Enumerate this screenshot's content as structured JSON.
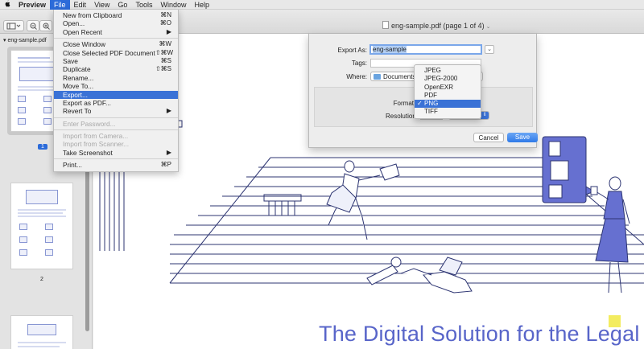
{
  "menubar": {
    "app": "Preview",
    "items": [
      "File",
      "Edit",
      "View",
      "Go",
      "Tools",
      "Window",
      "Help"
    ]
  },
  "window": {
    "title": "eng-sample.pdf (page 1 of 4)"
  },
  "sidebar": {
    "doc_name": "eng-sample.pdf",
    "pages": [
      "1",
      "2"
    ]
  },
  "file_menu": {
    "items": [
      {
        "label": "New from Clipboard",
        "shortcut": "⌘N"
      },
      {
        "label": "Open...",
        "shortcut": "⌘O"
      },
      {
        "label": "Open Recent",
        "shortcut": "▶"
      },
      {
        "label": "Close Window",
        "shortcut": "⌘W"
      },
      {
        "label": "Close Selected PDF Document",
        "shortcut": "⇧⌘W"
      },
      {
        "label": "Save",
        "shortcut": "⌘S"
      },
      {
        "label": "Duplicate",
        "shortcut": "⇧⌘S"
      },
      {
        "label": "Rename...",
        "shortcut": ""
      },
      {
        "label": "Move To...",
        "shortcut": ""
      },
      {
        "label": "Export...",
        "shortcut": ""
      },
      {
        "label": "Export as PDF...",
        "shortcut": ""
      },
      {
        "label": "Revert To",
        "shortcut": "▶"
      },
      {
        "label": "Enter Password...",
        "shortcut": ""
      },
      {
        "label": "Import from Camera...",
        "shortcut": ""
      },
      {
        "label": "Import from Scanner...",
        "shortcut": ""
      },
      {
        "label": "Take Screenshot",
        "shortcut": "▶"
      },
      {
        "label": "Print...",
        "shortcut": "⌘P"
      }
    ]
  },
  "export_sheet": {
    "export_as_label": "Export As:",
    "export_as_value": "eng-sample",
    "tags_label": "Tags:",
    "where_label": "Where:",
    "where_value": "Documents",
    "format_label": "Format",
    "resolution_label": "Resolution:",
    "cancel_label": "Cancel",
    "save_label": "Save"
  },
  "format_options": [
    "JPEG",
    "JPEG-2000",
    "OpenEXR",
    "PDF",
    "PNG",
    "TIFF"
  ],
  "format_selected": "PNG",
  "document": {
    "headline": "The Digital Solution for the Legal"
  },
  "colors": {
    "accent": "#3a72d6",
    "headline": "#5865c9",
    "illustration": "#2d3572",
    "illustration_fill": "#6670d0"
  }
}
